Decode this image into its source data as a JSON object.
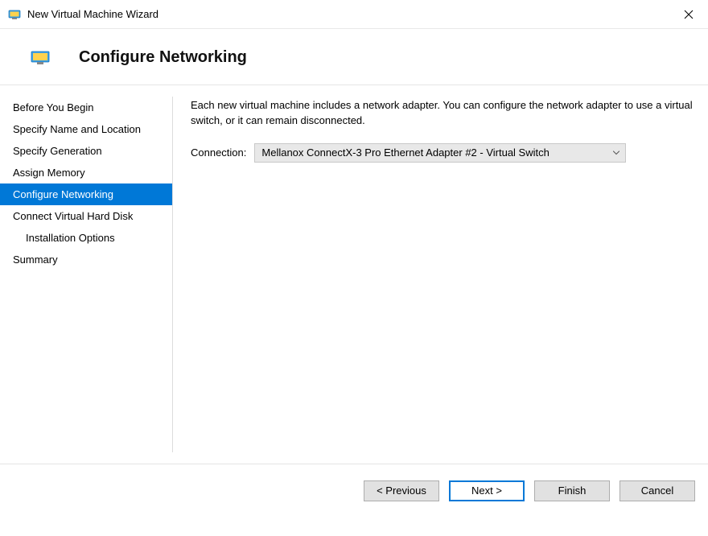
{
  "titlebar": {
    "title": "New Virtual Machine Wizard"
  },
  "header": {
    "title": "Configure Networking"
  },
  "steps": {
    "s0": "Before You Begin",
    "s1": "Specify Name and Location",
    "s2": "Specify Generation",
    "s3": "Assign Memory",
    "s4": "Configure Networking",
    "s5": "Connect Virtual Hard Disk",
    "s6": "Installation Options",
    "s7": "Summary"
  },
  "content": {
    "description": "Each new virtual machine includes a network adapter. You can configure the network adapter to use a virtual switch, or it can remain disconnected.",
    "connectionLabel": "Connection:",
    "connectionValue": "Mellanox ConnectX-3 Pro Ethernet Adapter #2 - Virtual Switch"
  },
  "footer": {
    "previous": "< Previous",
    "next": "Next >",
    "finish": "Finish",
    "cancel": "Cancel"
  }
}
